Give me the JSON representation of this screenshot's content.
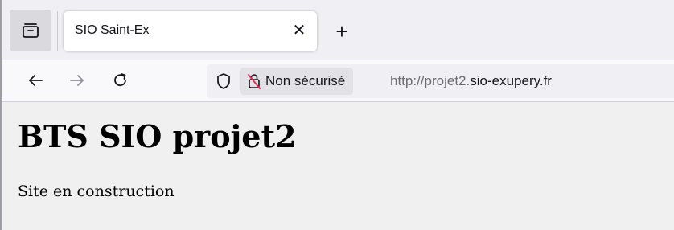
{
  "tab_strip": {
    "tab_list_icon": "tab-list-icon",
    "active_tab": {
      "title": "SIO Saint-Ex",
      "close_icon": "close-icon",
      "close_glyph": "✕"
    },
    "new_tab_icon": "plus-icon",
    "new_tab_glyph": "+"
  },
  "navigation": {
    "back_icon": "arrow-left-icon",
    "forward_icon": "arrow-right-icon",
    "reload_icon": "reload-icon",
    "url_bar": {
      "tracking_protection_icon": "shield-icon",
      "security_icon": "lock-slash-icon",
      "security_label": "Non sécurisé",
      "url_prefix": "http://projet2.",
      "url_domain": "sio-exupery.fr"
    }
  },
  "page": {
    "heading": "BTS SIO projet2",
    "text": "Site en construction"
  }
}
